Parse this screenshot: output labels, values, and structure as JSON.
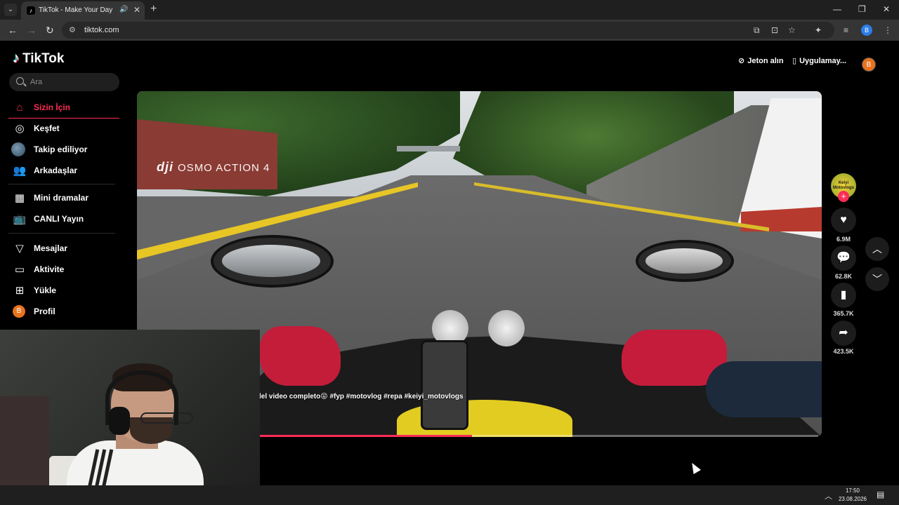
{
  "browser": {
    "tab_title": "TikTok - Make Your Day",
    "tab_favicon": "tiktok-note-icon",
    "url": "tiktok.com",
    "profile_initial": "B"
  },
  "tiktok": {
    "logo_text": "TikTok",
    "search_placeholder": "Ara",
    "nav": {
      "for_you": "Sizin İçin",
      "explore": "Keşfet",
      "following": "Takip ediliyor",
      "friends": "Arkadaşlar",
      "mini_dramas": "Mini dramalar",
      "live": "CANLI Yayın",
      "messages": "Mesajlar",
      "activity": "Aktivite",
      "upload": "Yükle",
      "profile": "Profil",
      "profile_initial": "B"
    },
    "header": {
      "get_coins": "Jeton alın",
      "get_app": "Uygulamay...",
      "avatar_initial": "B"
    },
    "video": {
      "watermark_brand": "dji",
      "watermark_product": "OSMO ACTION 4",
      "caption": "lel video completo😝 #fyp #motovlog #repa #keiyi_motovlogs",
      "progress_percent": 38,
      "accent_color": "#fe2c55"
    },
    "actions": {
      "creator_label": "Keiyi Motovlogs",
      "likes": "6.9M",
      "comments": "62.8K",
      "saves": "365.7K",
      "shares": "423.5K"
    }
  },
  "taskbar": {
    "time": "17:50",
    "date": "23.08.2026"
  }
}
